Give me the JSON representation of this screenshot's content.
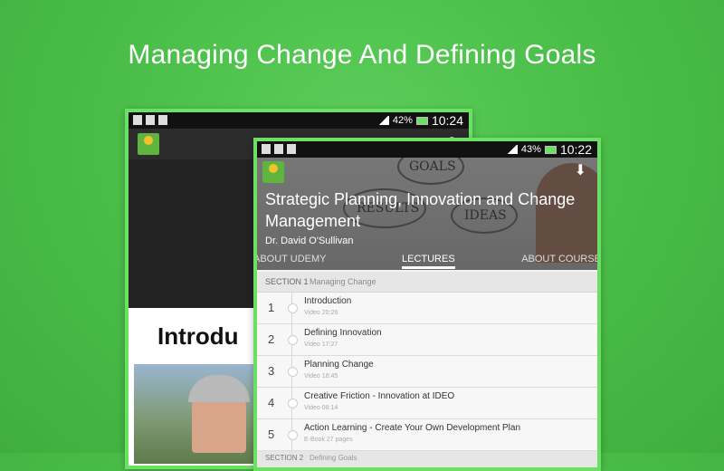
{
  "headline": "Managing Change And Defining Goals",
  "back_phone": {
    "status": {
      "battery": "42%",
      "time": "10:24"
    },
    "slide_title": "Introdu"
  },
  "front_phone": {
    "status": {
      "battery": "43%",
      "time": "10:22"
    },
    "course_title": "Strategic Planning, Innovation and Change Management",
    "author": "Dr. David O'Sullivan",
    "hero_doodles": [
      "GOALS",
      "RESULTS",
      "IDEAS"
    ],
    "tabs": {
      "left": "ABOUT UDEMY",
      "active": "LECTURES",
      "right": "ABOUT COURSE"
    },
    "section1": {
      "number": "SECTION 1",
      "name": "Managing Change"
    },
    "lectures": [
      {
        "index": "1",
        "title": "Introduction",
        "meta": "Video 20:26"
      },
      {
        "index": "2",
        "title": "Defining Innovation",
        "meta": "Video 17:27"
      },
      {
        "index": "3",
        "title": "Planning Change",
        "meta": "Video 18:45"
      },
      {
        "index": "4",
        "title": "Creative Friction - Innovation at IDEO",
        "meta": "Video 08:14"
      },
      {
        "index": "5",
        "title": "Action Learning - Create Your Own Development Plan",
        "meta": "E-Book 27 pages"
      }
    ],
    "section2": {
      "number": "SECTION 2",
      "name": "Defining Goals"
    }
  },
  "colors": {
    "background": "#4bbf49",
    "frame": "#6be062",
    "logo_bg": "#5fb33f"
  }
}
